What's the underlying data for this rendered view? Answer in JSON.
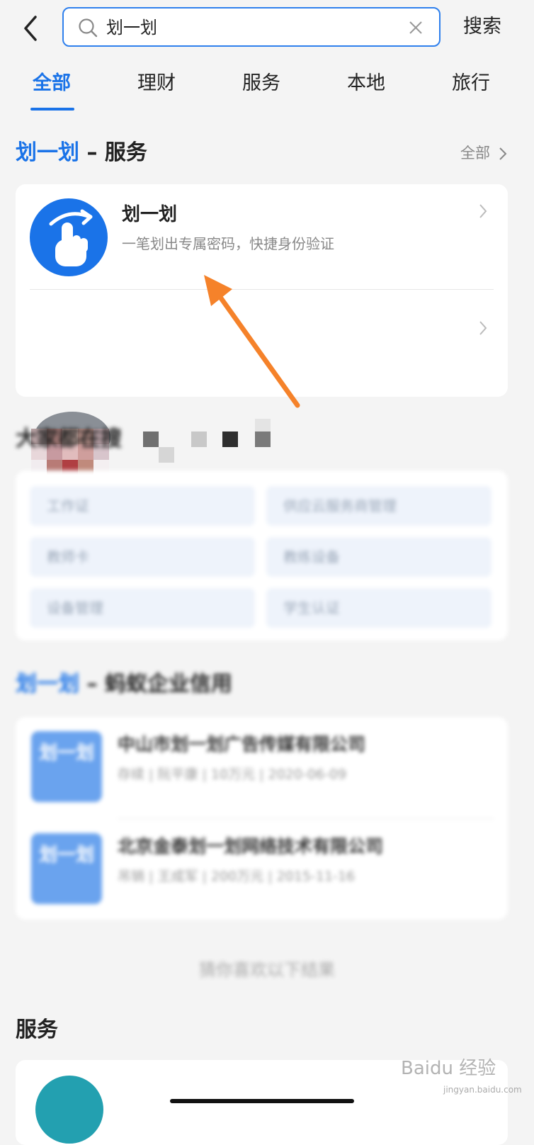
{
  "header": {
    "search_value": "划一划",
    "search_button": "搜索"
  },
  "tabs": [
    {
      "label": "全部",
      "active": true
    },
    {
      "label": "理财"
    },
    {
      "label": "服务"
    },
    {
      "label": "本地"
    },
    {
      "label": "旅行"
    }
  ],
  "service_section": {
    "title_highlight": "划一划",
    "title_suffix": " – 服务",
    "see_all": "全部",
    "items": [
      {
        "name": "划一划",
        "desc": "一笔划出专属密码，快捷身份验证",
        "icon": "swipe-hand-icon"
      }
    ]
  },
  "popular": {
    "title": "大家都在搜",
    "chips": [
      "工作证",
      "供应云服务商管理",
      "教师卡",
      "教练设备",
      "设备管理",
      "学生认证"
    ]
  },
  "enterprise_section": {
    "title_highlight": "划一划",
    "title_suffix": " – 蚂蚁企业信用",
    "items": [
      {
        "logo": "划一划",
        "name": "中山市划一划广告传媒有限公司",
        "meta": "存续 | 阮平康 | 10万元 | 2020-06-09"
      },
      {
        "logo": "划一划",
        "name": "北京金泰划一划网络技术有限公司",
        "meta": "吊销 | 王成军 | 200万元 | 2015-11-16"
      }
    ]
  },
  "guess_text": "猜你喜欢以下结果",
  "service_section_2": {
    "title": "服务"
  },
  "watermark": {
    "main": "Baidu 经验",
    "sub": "jingyan.baidu.com"
  },
  "colors": {
    "accent": "#1a73e8",
    "arrow": "#f5822a"
  }
}
